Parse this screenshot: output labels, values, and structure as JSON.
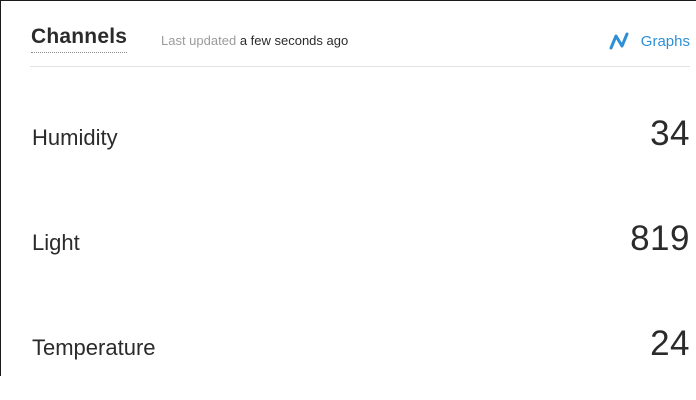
{
  "header": {
    "title": "Channels",
    "updated_prefix": "Last updated",
    "updated_time": "a few seconds ago",
    "graphs_label": "Graphs",
    "graphs_icon": "line-chart-icon"
  },
  "colors": {
    "accent": "#2f8fd6",
    "text": "#2b2b2b",
    "muted": "#9b9b9b",
    "divider": "#e3e3e3"
  },
  "channels": [
    {
      "label": "Humidity",
      "value": "34"
    },
    {
      "label": "Light",
      "value": "819"
    },
    {
      "label": "Temperature",
      "value": "24"
    }
  ]
}
